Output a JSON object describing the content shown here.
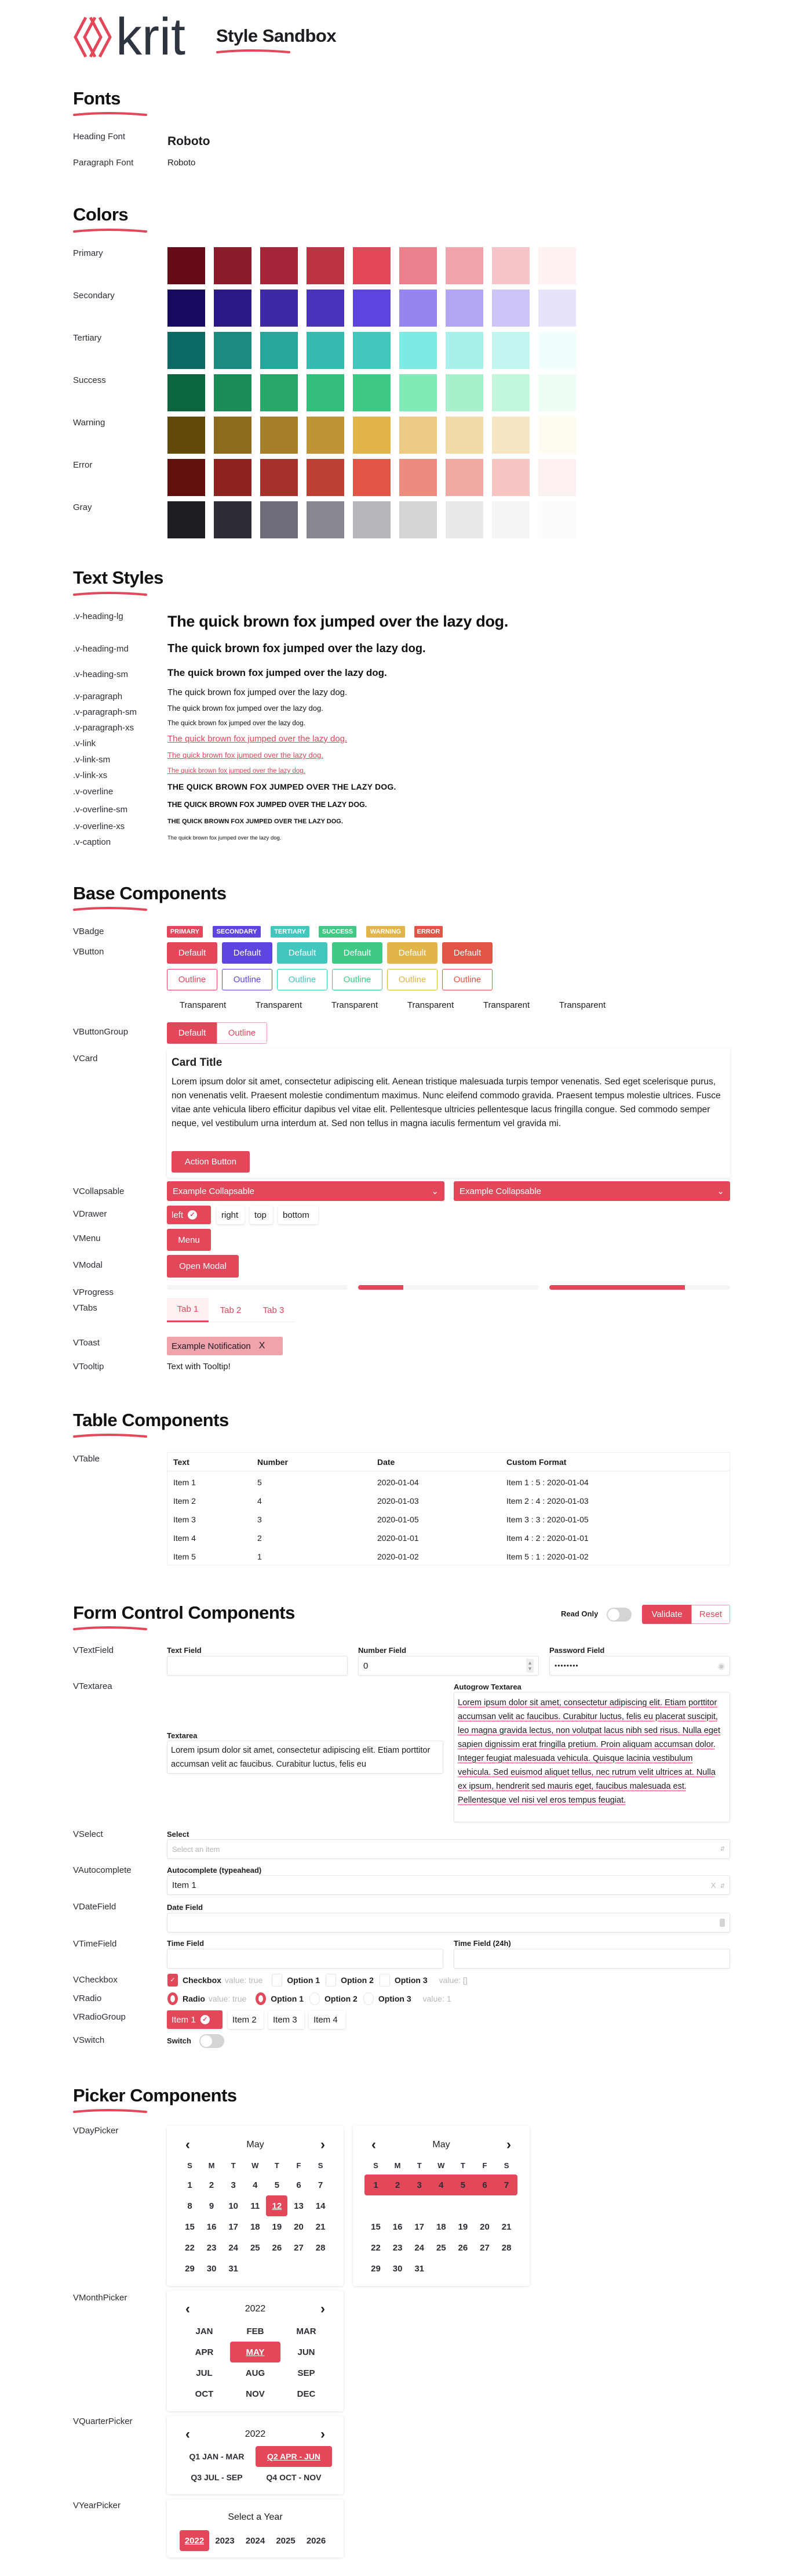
{
  "header": {
    "logo_text": "krit",
    "title": "Style Sandbox"
  },
  "accent": "#e2475a",
  "fonts": {
    "title": "Fonts",
    "rows": [
      {
        "label": "Heading Font",
        "value": "Roboto"
      },
      {
        "label": "Paragraph Font",
        "value": "Roboto"
      }
    ]
  },
  "colors": {
    "title": "Colors",
    "palettes": [
      {
        "name": "Primary",
        "shades": [
          "#640b17",
          "#8b1a2a",
          "#a42638",
          "#bd3344",
          "#e2475a",
          "#eb808d",
          "#f0a3ac",
          "#f6c3c8",
          "#fdf1f2"
        ]
      },
      {
        "name": "Secondary",
        "shades": [
          "#160a5e",
          "#2a1a85",
          "#3b29a6",
          "#4733be",
          "#5c46df",
          "#9585ee",
          "#b1a7f2",
          "#cbc4f6",
          "#e6e3fc"
        ]
      },
      {
        "name": "Tertiary",
        "shades": [
          "#0b6963",
          "#1b8a80",
          "#28a69c",
          "#35bbb1",
          "#41c7be",
          "#7fe9e3",
          "#a6f1eb",
          "#c3f6f1",
          "#f0fefd"
        ]
      },
      {
        "name": "Success",
        "shades": [
          "#0b663d",
          "#1c8b58",
          "#29a76b",
          "#35bd7b",
          "#3fc985",
          "#81ebb7",
          "#a6f0cb",
          "#c3f7dc",
          "#effef5"
        ]
      },
      {
        "name": "Warning",
        "shades": [
          "#62480b",
          "#8c6b1e",
          "#a57f2a",
          "#be9437",
          "#e2b54a",
          "#ecca83",
          "#f2dba7",
          "#f6e6c4",
          "#fffbf1"
        ]
      },
      {
        "name": "Error",
        "shades": [
          "#62100b",
          "#8d231e",
          "#a6312a",
          "#bd4035",
          "#e15546",
          "#ec8b80",
          "#f0aaa3",
          "#f6c5c1",
          "#fdf1f0"
        ]
      },
      {
        "name": "Gray",
        "shades": [
          "#1d1d22",
          "#2e2d36",
          "#6e6c78",
          "#888690",
          "#b7b6bc",
          "#d4d4d6",
          "#e9e9ea",
          "#f5f5f5",
          "#fcfcfc"
        ]
      }
    ]
  },
  "text_styles": {
    "title": "Text Styles",
    "rows": [
      {
        "label": ".v-heading-lg",
        "text": "The quick brown fox jumped over the lazy dog."
      },
      {
        "label": ".v-heading-md",
        "text": "The quick brown fox jumped over the lazy dog."
      },
      {
        "label": ".v-heading-sm",
        "text": "The quick brown fox jumped over the lazy dog."
      },
      {
        "label": ".v-paragraph",
        "text": "The quick brown fox jumped over the lazy dog."
      },
      {
        "label": ".v-paragraph-sm",
        "text": "The quick brown fox jumped over the lazy dog."
      },
      {
        "label": ".v-paragraph-xs",
        "text": "The quick brown fox jumped over the lazy dog."
      },
      {
        "label": ".v-link",
        "text": "The quick brown fox jumped over the lazy dog."
      },
      {
        "label": ".v-link-sm",
        "text": "The quick brown fox jumped over the lazy dog."
      },
      {
        "label": ".v-link-xs",
        "text": "The quick brown fox jumped over the lazy dog."
      },
      {
        "label": ".v-overline",
        "text": "THE QUICK BROWN FOX JUMPED OVER THE LAZY DOG."
      },
      {
        "label": ".v-overline-sm",
        "text": "THE QUICK BROWN FOX JUMPED OVER THE LAZY DOG."
      },
      {
        "label": ".v-overline-xs",
        "text": "THE QUICK BROWN FOX JUMPED OVER THE LAZY DOG."
      },
      {
        "label": ".v-caption",
        "text": "The quick brown fox jumped over the lazy dog."
      }
    ]
  },
  "base": {
    "title": "Base Components",
    "labels": {
      "badge": "VBadge",
      "button": "VButton",
      "button_group": "VButtonGroup",
      "card": "VCard",
      "collapsable": "VCollapsable",
      "drawer": "VDrawer",
      "menu": "VMenu",
      "modal": "VModal",
      "progress": "VProgress",
      "tabs": "VTabs",
      "toast": "VToast",
      "tooltip": "VTooltip"
    },
    "variants": [
      {
        "name": "primary",
        "badge": "PRIMARY",
        "color": "#e2475a"
      },
      {
        "name": "secondary",
        "badge": "SECONDARY",
        "color": "#5c46df"
      },
      {
        "name": "tertiary",
        "badge": "TERTIARY",
        "color": "#41c7be"
      },
      {
        "name": "success",
        "badge": "SUCCESS",
        "color": "#3fc985"
      },
      {
        "name": "warning",
        "badge": "WARNING",
        "color": "#e2b54a"
      },
      {
        "name": "error",
        "badge": "ERROR",
        "color": "#e15546"
      }
    ],
    "button_default": "Default",
    "button_outline": "Outline",
    "button_transparent": "Transparent",
    "group": {
      "default": "Default",
      "outline": "Outline"
    },
    "card": {
      "title": "Card Title",
      "body": "Lorem ipsum dolor sit amet, consectetur adipiscing elit. Aenean tristique malesuada turpis tempor venenatis. Sed eget scelerisque purus, non venenatis velit. Praesent molestie condimentum maximus. Nunc eleifend commodo gravida. Praesent tempus molestie ultrices. Fusce vitae ante vehicula libero efficitur dapibus vel vitae elit. Pellentesque ultricies pellentesque lacus fringilla congue. Sed commodo semper neque, vel vestibulum urna interdum at. Sed non tellus in magna iaculis fermentum vel gravida mi.",
      "action": "Action Button"
    },
    "collapsables": [
      "Example Collapsable",
      "Example Collapsable"
    ],
    "drawer": {
      "options": [
        "left",
        "right",
        "top",
        "bottom"
      ],
      "selected": "left"
    },
    "menu": "Menu",
    "modal": "Open Modal",
    "progress": [
      0,
      25,
      75
    ],
    "tabs": {
      "items": [
        "Tab 1",
        "Tab 2",
        "Tab 3"
      ],
      "active": 0
    },
    "toast": {
      "text": "Example Notification",
      "close": "X"
    },
    "tooltip": "Text with Tooltip!"
  },
  "table": {
    "title": "Table Components",
    "label": "VTable",
    "columns": [
      "Text",
      "Number",
      "Date",
      "Custom Format"
    ],
    "rows": [
      [
        "Item 1",
        "5",
        "2020-01-04",
        "Item 1 : 5 : 2020-01-04"
      ],
      [
        "Item 2",
        "4",
        "2020-01-03",
        "Item 2 : 4 : 2020-01-03"
      ],
      [
        "Item 3",
        "3",
        "2020-01-05",
        "Item 3 : 3 : 2020-01-05"
      ],
      [
        "Item 4",
        "2",
        "2020-01-01",
        "Item 4 : 2 : 2020-01-01"
      ],
      [
        "Item 5",
        "1",
        "2020-01-02",
        "Item 5 : 1 : 2020-01-02"
      ]
    ]
  },
  "form": {
    "title": "Form Control Components",
    "read_only_label": "Read Only",
    "read_only": false,
    "validate": "Validate",
    "reset": "Reset",
    "labels": {
      "textfield": "VTextField",
      "textarea": "VTextarea",
      "select": "VSelect",
      "autocomplete": "VAutocomplete",
      "datefield": "VDateField",
      "timefield": "VTimeField",
      "checkbox": "VCheckbox",
      "radio": "VRadio",
      "radiogroup": "VRadioGroup",
      "switch": "VSwitch"
    },
    "text_field": {
      "label": "Text Field",
      "value": ""
    },
    "number_field": {
      "label": "Number Field",
      "value": "0"
    },
    "password_field": {
      "label": "Password Field",
      "value": "••••••••"
    },
    "textarea": {
      "label": "Textarea",
      "value": "Lorem ipsum dolor sit amet, consectetur adipiscing elit. Etiam porttitor accumsan velit ac faucibus. Curabitur luctus, felis eu"
    },
    "autogrow": {
      "label": "Autogrow Textarea",
      "value": "Lorem ipsum dolor sit amet, consectetur adipiscing elit. Etiam porttitor accumsan velit ac faucibus. Curabitur luctus, felis eu placerat suscipit, leo magna gravida lectus, non volutpat lacus nibh sed risus. Nulla eget sapien dignissim erat fringilla pretium. Proin aliquam accumsan dolor. Integer feugiat malesuada vehicula. Quisque lacinia vestibulum vehicula. Sed euismod aliquet tellus, nec rutrum velit ultrices at. Nulla ex ipsum, hendrerit sed mauris eget, faucibus malesuada est. Pellentesque vel nisi vel eros tempus feugiat."
    },
    "select": {
      "label": "Select",
      "placeholder": "Select an item"
    },
    "autocomplete": {
      "label": "Autocomplete (typeahead)",
      "value": "Item 1",
      "clear": "X"
    },
    "date_field": {
      "label": "Date Field",
      "value": ""
    },
    "time_field": {
      "label": "Time Field",
      "value": ""
    },
    "time_field_24": {
      "label": "Time Field (24h)",
      "value": ""
    },
    "checkbox": {
      "label": "Checkbox",
      "checked": true,
      "value_text": "value: true",
      "options": [
        "Option 1",
        "Option 2",
        "Option 3"
      ],
      "group_value_text": "value: []"
    },
    "radio": {
      "label": "Radio",
      "value_text": "value: true",
      "options": [
        "Option 1",
        "Option 2",
        "Option 3"
      ],
      "selected": 0,
      "group_value_text": "value: 1"
    },
    "radio_group": {
      "items": [
        "Item 1",
        "Item 2",
        "Item 3",
        "Item 4"
      ],
      "selected": 0
    },
    "switch": {
      "label": "Switch",
      "on": false
    }
  },
  "pickers": {
    "title": "Picker Components",
    "labels": {
      "day": "VDayPicker",
      "month": "VMonthPicker",
      "quarter": "VQuarterPicker",
      "year": "VYearPicker"
    },
    "day": {
      "month": "May",
      "weekdays": [
        "S",
        "M",
        "T",
        "W",
        "T",
        "F",
        "S"
      ],
      "days_in_month": 31,
      "first_weekday": 0,
      "selected_day": 12,
      "selected_week": [
        8,
        9,
        10,
        11,
        12,
        13,
        14
      ]
    },
    "month": {
      "year": "2022",
      "months": [
        "JAN",
        "FEB",
        "MAR",
        "APR",
        "MAY",
        "JUN",
        "JUL",
        "AUG",
        "SEP",
        "OCT",
        "NOV",
        "DEC"
      ],
      "selected": "MAY"
    },
    "quarter": {
      "year": "2022",
      "quarters": [
        "Q1 JAN - MAR",
        "Q2 APR - JUN",
        "Q3 JUL - SEP",
        "Q4 OCT - NOV"
      ],
      "selected": 1
    },
    "year": {
      "title": "Select a Year",
      "years": [
        "2022",
        "2023",
        "2024",
        "2025",
        "2026"
      ],
      "selected": "2022"
    }
  }
}
